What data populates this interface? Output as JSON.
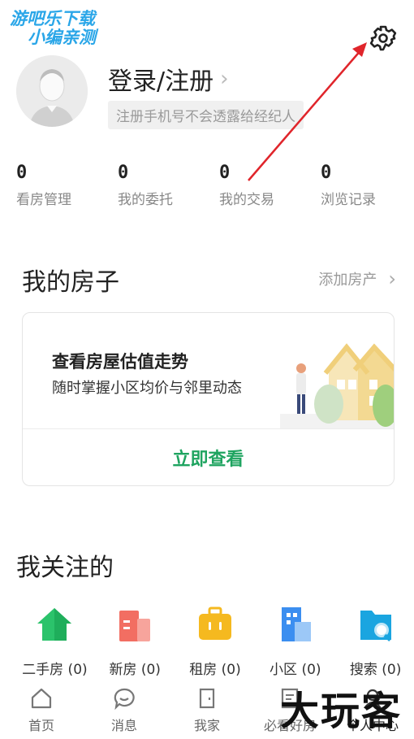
{
  "watermark_top": {
    "line1": "游吧乐下载",
    "line2": "小编亲测"
  },
  "watermark_bottom": "大玩客",
  "header": {
    "login_text": "登录/注册",
    "login_chevron": "›",
    "login_tip": "注册手机号不会透露给经纪人"
  },
  "stats": [
    {
      "value": "0",
      "label": "看房管理"
    },
    {
      "value": "0",
      "label": "我的委托"
    },
    {
      "value": "0",
      "label": "我的交易"
    },
    {
      "value": "0",
      "label": "浏览记录"
    }
  ],
  "my_house": {
    "title": "我的房子",
    "add_label": "添加房产",
    "add_chevron": "›",
    "card_title": "查看房屋估值走势",
    "card_subtitle": "随时掌握小区均价与邻里动态",
    "cta": "立即查看"
  },
  "following": {
    "title": "我关注的",
    "items": [
      {
        "label": "二手房 (0)",
        "icon": "home-icon",
        "color": "#2bc36b"
      },
      {
        "label": "新房 (0)",
        "icon": "building-icon",
        "color": "#f26e62"
      },
      {
        "label": "租房 (0)",
        "icon": "suitcase-icon",
        "color": "#f5b91f"
      },
      {
        "label": "小区 (0)",
        "icon": "tower-icon",
        "color": "#3b8ef0"
      },
      {
        "label": "搜索 (0)",
        "icon": "search-folder-icon",
        "color": "#1aa5e0"
      }
    ]
  },
  "tabbar": [
    {
      "label": "首页",
      "icon": "home-outline-icon"
    },
    {
      "label": "消息",
      "icon": "chat-icon"
    },
    {
      "label": "我家",
      "icon": "door-icon"
    },
    {
      "label": "必看好房",
      "icon": "document-icon"
    },
    {
      "label": "个人中心",
      "icon": "person-icon"
    }
  ],
  "colors": {
    "accent_green": "#1fa460",
    "annotation_red": "#e0252b"
  }
}
